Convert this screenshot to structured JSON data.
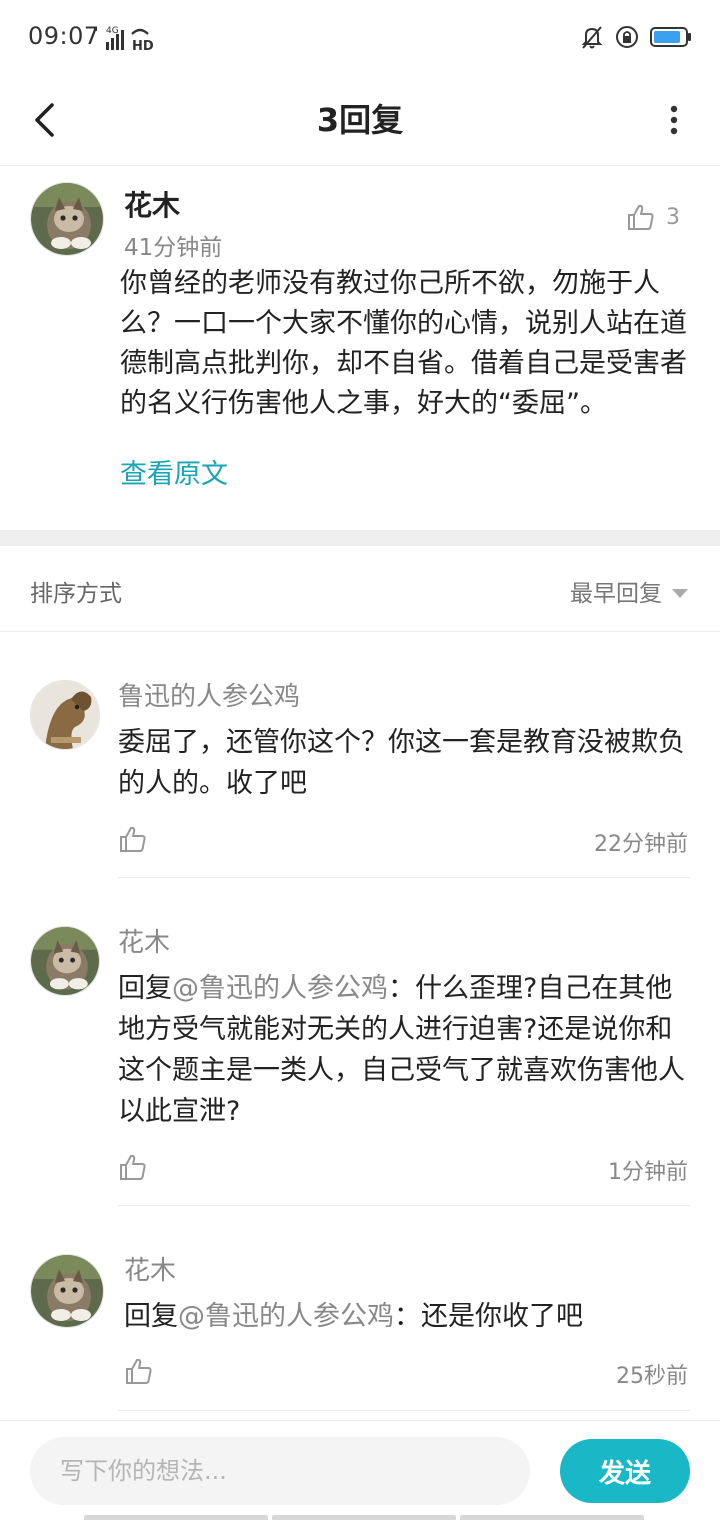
{
  "status_bar": {
    "time": "09:07",
    "network": "4G",
    "hd": "HD",
    "icons": [
      "mute-bell-icon",
      "rotation-lock-icon",
      "battery-icon"
    ],
    "battery_color": "#3aa0f0"
  },
  "header": {
    "title": "3回复",
    "back_icon": "chevron-left-icon",
    "more_icon": "more-vertical-icon"
  },
  "main_comment": {
    "author": "花木",
    "time": "41分钟前",
    "likes": "3",
    "text": "你曾经的老师没有教过你己所不欲，勿施于人么？一口一个大家不懂你的心情，说别人站在道德制高点批判你，却不自省。借着自己是受害者的名义行伤害他人之事，好大的“委屈”。",
    "view_original": "查看原文"
  },
  "sort": {
    "label": "排序方式",
    "selected": "最早回复"
  },
  "replies": [
    {
      "author": "鲁迅的人参公鸡",
      "mention_prefix": "",
      "mention": "",
      "mention_suffix": "",
      "text": "委屈了，还管你这个？你这一套是教育没被欺负的人的。收了吧",
      "time": "22分钟前"
    },
    {
      "author": "花木",
      "mention_prefix": "回复",
      "mention": "@鲁迅的人参公鸡",
      "mention_suffix": "：",
      "text": "什么歪理?自己在其他地方受气就能对无关的人进行迫害?还是说你和这个题主是一类人，自己受气了就喜欢伤害他人以此宣泄?",
      "time": "1分钟前"
    },
    {
      "author": "花木",
      "mention_prefix": "回复",
      "mention": "@鲁迅的人参公鸡",
      "mention_suffix": "：",
      "text": "还是你收了吧",
      "time": "25秒前"
    }
  ],
  "composer": {
    "placeholder": "写下你的想法...",
    "send_label": "发送",
    "accent": "#1ab8c7"
  },
  "link_color": "#1aa4b7"
}
